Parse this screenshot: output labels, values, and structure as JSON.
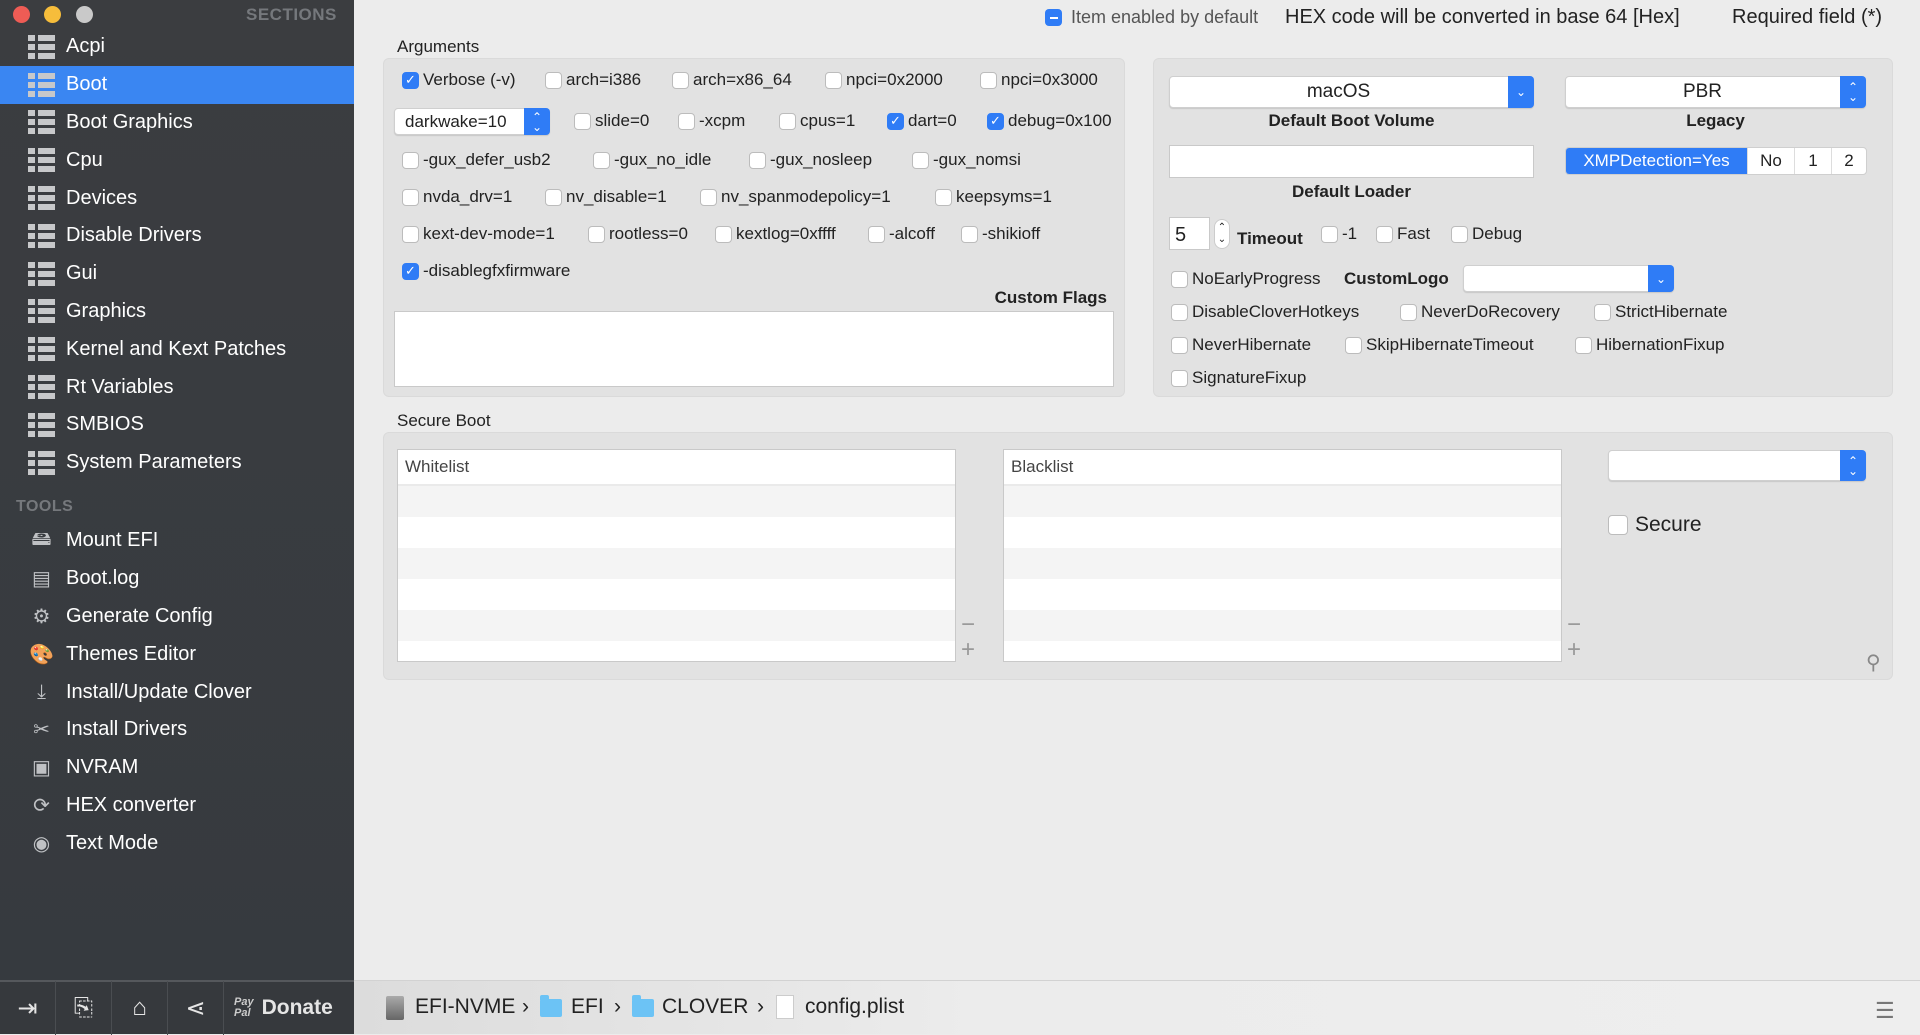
{
  "window": {
    "traffic_lights": [
      "#ee5c55",
      "#f6bd3b",
      "#c9c9c9"
    ]
  },
  "sidebar": {
    "sections_header": "SECTIONS",
    "sections": [
      {
        "label": "Acpi"
      },
      {
        "label": "Boot",
        "active": true
      },
      {
        "label": "Boot Graphics"
      },
      {
        "label": "Cpu"
      },
      {
        "label": "Devices"
      },
      {
        "label": "Disable Drivers"
      },
      {
        "label": "Gui"
      },
      {
        "label": "Graphics"
      },
      {
        "label": "Kernel and Kext Patches"
      },
      {
        "label": "Rt Variables"
      },
      {
        "label": "SMBIOS"
      },
      {
        "label": "System Parameters"
      }
    ],
    "tools_header": "TOOLS",
    "tools": [
      {
        "label": "Mount EFI",
        "icon": "disk-icon"
      },
      {
        "label": "Boot.log",
        "icon": "log-icon"
      },
      {
        "label": "Generate Config",
        "icon": "gears-icon"
      },
      {
        "label": "Themes Editor",
        "icon": "palette-icon"
      },
      {
        "label": "Install/Update Clover",
        "icon": "download-icon"
      },
      {
        "label": "Install Drivers",
        "icon": "tools-icon"
      },
      {
        "label": "NVRAM",
        "icon": "chip-icon"
      },
      {
        "label": "HEX converter",
        "icon": "refresh-icon"
      },
      {
        "label": "Text Mode",
        "icon": "eye-icon"
      }
    ],
    "bottom": {
      "paypal_top": "Pay",
      "paypal_bottom": "Pal",
      "donate": "Donate"
    }
  },
  "header": {
    "item_enabled": "Item enabled by default",
    "hex_note": "HEX code will be converted in base 64 [Hex]",
    "required": "Required field (*)"
  },
  "arguments": {
    "title": "Arguments",
    "row1": [
      {
        "label": "Verbose (-v)",
        "checked": true
      },
      {
        "label": "arch=i386",
        "checked": false
      },
      {
        "label": "arch=x86_64",
        "checked": false
      },
      {
        "label": "npci=0x2000",
        "checked": false
      },
      {
        "label": "npci=0x3000",
        "checked": false
      }
    ],
    "darkwake": "darkwake=10",
    "row2": [
      {
        "label": "slide=0",
        "checked": false
      },
      {
        "label": "-xcpm",
        "checked": false
      },
      {
        "label": "cpus=1",
        "checked": false
      },
      {
        "label": "dart=0",
        "checked": true
      },
      {
        "label": "debug=0x100",
        "checked": true
      }
    ],
    "row3": [
      {
        "label": "-gux_defer_usb2",
        "checked": false
      },
      {
        "label": "-gux_no_idle",
        "checked": false
      },
      {
        "label": "-gux_nosleep",
        "checked": false
      },
      {
        "label": "-gux_nomsi",
        "checked": false
      }
    ],
    "row4": [
      {
        "label": "nvda_drv=1",
        "checked": false
      },
      {
        "label": "nv_disable=1",
        "checked": false
      },
      {
        "label": "nv_spanmodepolicy=1",
        "checked": false
      },
      {
        "label": "keepsyms=1",
        "checked": false
      }
    ],
    "row5": [
      {
        "label": "kext-dev-mode=1",
        "checked": false
      },
      {
        "label": "rootless=0",
        "checked": false
      },
      {
        "label": "kextlog=0xffff",
        "checked": false
      },
      {
        "label": "-alcoff",
        "checked": false
      },
      {
        "label": "-shikioff",
        "checked": false
      }
    ],
    "row6": [
      {
        "label": "-disablegfxfirmware",
        "checked": true
      }
    ],
    "custom_flags_label": "Custom Flags",
    "custom_flags_value": ""
  },
  "boot": {
    "default_volume": "macOS",
    "default_volume_label": "Default Boot Volume",
    "legacy": "PBR",
    "legacy_label": "Legacy",
    "default_loader": "",
    "default_loader_label": "Default Loader",
    "xmp": [
      "XMPDetection=Yes",
      "No",
      "1",
      "2"
    ],
    "timeout": "5",
    "timeout_label": "Timeout",
    "opts1": [
      {
        "label": "-1",
        "checked": false
      },
      {
        "label": "Fast",
        "checked": false
      },
      {
        "label": "Debug",
        "checked": false
      }
    ],
    "no_early": {
      "label": "NoEarlyProgress",
      "checked": false
    },
    "custom_logo_label": "CustomLogo",
    "custom_logo": "",
    "row_a": [
      {
        "label": "DisableCloverHotkeys",
        "checked": false
      },
      {
        "label": "NeverDoRecovery",
        "checked": false
      },
      {
        "label": "StrictHibernate",
        "checked": false
      }
    ],
    "row_b": [
      {
        "label": "NeverHibernate",
        "checked": false
      },
      {
        "label": "SkipHibernateTimeout",
        "checked": false
      },
      {
        "label": "HibernationFixup",
        "checked": false
      }
    ],
    "row_c": [
      {
        "label": "SignatureFixup",
        "checked": false
      }
    ]
  },
  "secure_boot": {
    "title": "Secure Boot",
    "whitelist": "Whitelist",
    "blacklist": "Blacklist",
    "policy": "",
    "secure": {
      "label": "Secure",
      "checked": false
    }
  },
  "path": {
    "volume": "EFI-NVME",
    "sep": "›",
    "folder1": "EFI",
    "folder2": "CLOVER",
    "file": "config.plist"
  },
  "colors": {
    "accent": "#2f7cf6",
    "sidebar": "#3a3d41",
    "selected": "#3a86f2"
  }
}
